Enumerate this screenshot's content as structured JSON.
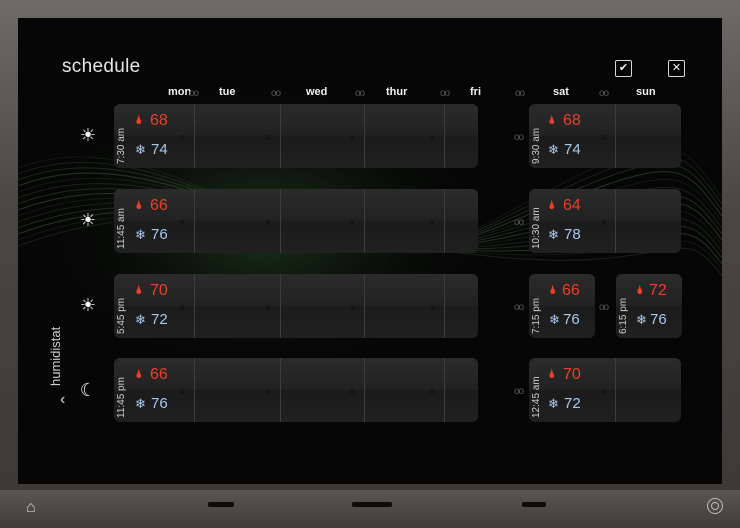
{
  "title": "schedule",
  "header_buttons": {
    "confirm_icon": "check-icon",
    "cancel_icon": "close-icon",
    "confirm_glyph": "✔",
    "cancel_glyph": "✕"
  },
  "days": [
    "mon",
    "tue",
    "wed",
    "thur",
    "fri",
    "sat",
    "sun"
  ],
  "link_glyph": "oo",
  "x_glyph": "x",
  "heat_glyph": "🌢",
  "cool_glyph": "❄",
  "side_label": "humidistat",
  "back_glyph": "‹",
  "periods": [
    {
      "icon": "sun-icon",
      "icon_glyph": "☀",
      "weekday": {
        "time": "7:30 am",
        "heat": "68",
        "cool": "74"
      },
      "weekend": [
        {
          "time": "9:30 am",
          "heat": "68",
          "cool": "74"
        }
      ]
    },
    {
      "icon": "sun-icon",
      "icon_glyph": "☀",
      "weekday": {
        "time": "11:45 am",
        "heat": "66",
        "cool": "76"
      },
      "weekend": [
        {
          "time": "10:30 am",
          "heat": "64",
          "cool": "78"
        }
      ]
    },
    {
      "icon": "sun-icon",
      "icon_glyph": "☀",
      "weekday": {
        "time": "5:45 pm",
        "heat": "70",
        "cool": "72"
      },
      "weekend": [
        {
          "time": "7:15 pm",
          "heat": "66",
          "cool": "76"
        },
        {
          "time": "6:15 pm",
          "heat": "72",
          "cool": "76"
        }
      ]
    },
    {
      "icon": "moon-icon",
      "icon_glyph": "☾",
      "weekday": {
        "time": "11:45 pm",
        "heat": "66",
        "cool": "76"
      },
      "weekend": [
        {
          "time": "12:45 am",
          "heat": "70",
          "cool": "72"
        }
      ]
    }
  ],
  "bottom_bar": {
    "home_icon": "home-icon",
    "home_glyph": "⌂",
    "settings_icon": "settings-circle-icon"
  }
}
